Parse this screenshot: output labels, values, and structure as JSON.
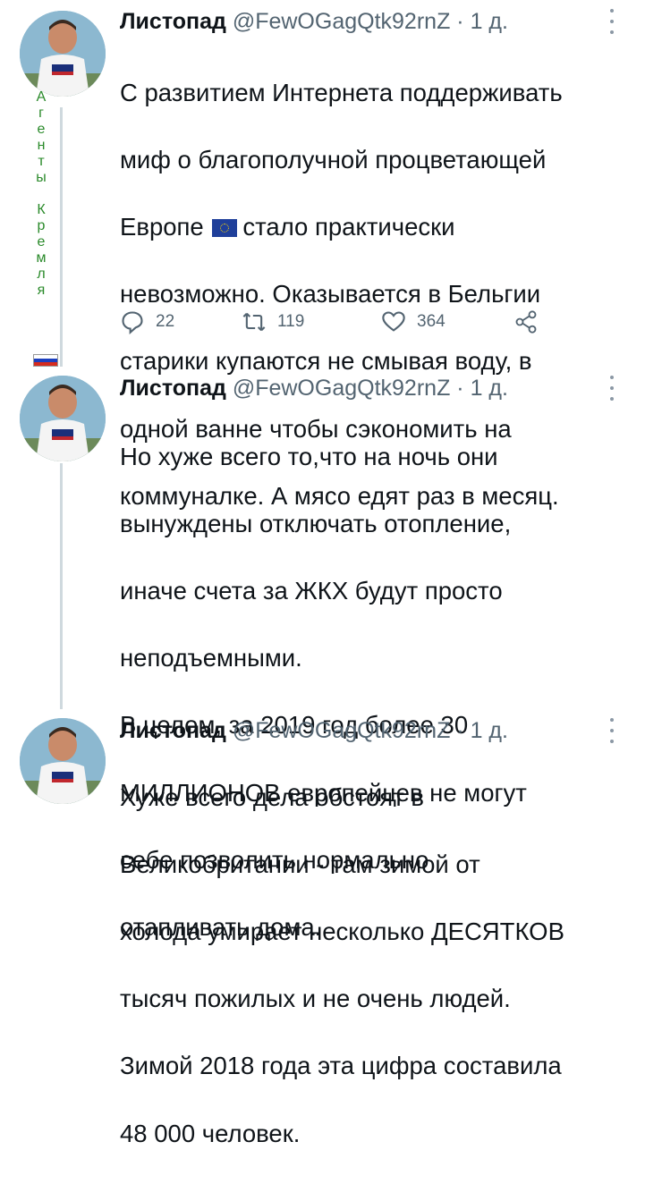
{
  "side_label": {
    "letters": [
      "А",
      "г",
      "е",
      "н",
      "т",
      "ы",
      "",
      "К",
      "р",
      "е",
      "м",
      "л",
      "я"
    ],
    "flag_colors": [
      "#ffffff",
      "#1c3fbf",
      "#d52b1e"
    ]
  },
  "tweets": [
    {
      "name": "Листопад",
      "handle": "@FewOGagQtk92rnZ",
      "dot": "·",
      "age": "1 д.",
      "lines": [
        "С развитием Интернета поддерживать",
        "миф о благополучной процветающей",
        "Европе",
        "стало практически",
        "невозможно. Оказывается в Бельгии",
        "старики купаются не смывая воду, в",
        "одной ванне чтобы сэкономить на",
        "коммуналке. А мясо едят раз в месяц."
      ],
      "actions": {
        "replies": "22",
        "retweets": "119",
        "likes": "364"
      }
    },
    {
      "name": "Листопад",
      "handle": "@FewOGagQtk92rnZ",
      "dot": "·",
      "age": "1 д.",
      "lines": [
        "Но хуже всего то,что на ночь они",
        "вынуждены отключать отопление,",
        "иначе счета за ЖКХ будут просто",
        "неподъемными.",
        "В целом, за 2019 год более 30",
        "МИЛЛИОНОВ европейцев не могут",
        "себе позволить нормально",
        "отапливать дома."
      ]
    },
    {
      "name": "Листопад",
      "handle": "@FewOGagQtk92rnZ",
      "dot": "·",
      "age": "1 д.",
      "lines": [
        "Хуже всего дела обстоят в",
        "Великобритании - там зимой от",
        "холода умирает несколько ДЕСЯТКОВ",
        "тысяч пожилых и не очень людей.",
        "Зимой 2018 года эта цифра составила",
        "48 000 человек."
      ]
    }
  ],
  "colors": {
    "text": "#0f1419",
    "muted": "#536471",
    "thread": "#cfd9de"
  }
}
